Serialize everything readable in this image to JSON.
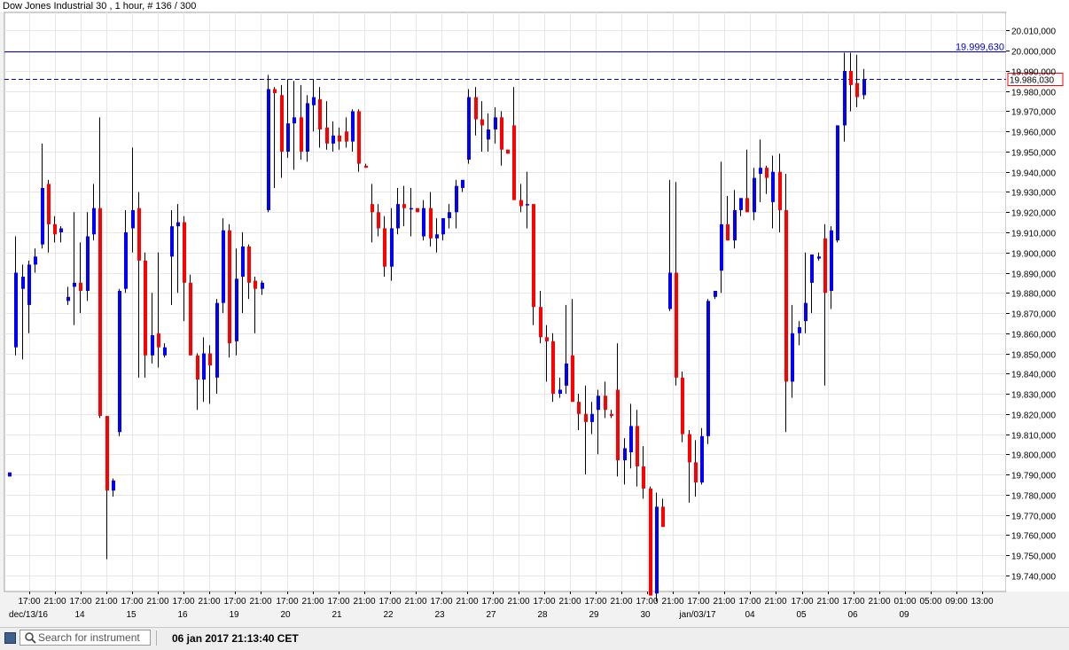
{
  "window": {
    "title": "Dow Jones Industrial 30 , 1 hour, # 136 / 300"
  },
  "search": {
    "placeholder": "Search for instrument"
  },
  "status": {
    "timestamp": "06 jan 2017 21:13:40 CET"
  },
  "icons": {
    "search": "search-icon",
    "bookmark": "bookmark-icon"
  },
  "colors": {
    "up": "#0000ff",
    "down": "#ff0000",
    "wick": "#000000",
    "level_line": "#0000c8",
    "price_label_border": "#ff0000"
  },
  "chart_data": {
    "type": "candlestick",
    "title": "Dow Jones Industrial 30 , 1 hour, # 136 / 300",
    "grid": true,
    "y_axis_position": "right",
    "ylim": [
      19732,
      20019
    ],
    "yticks": [
      19740,
      19750,
      19760,
      19770,
      19780,
      19790,
      19800,
      19810,
      19820,
      19830,
      19840,
      19850,
      19860,
      19870,
      19880,
      19890,
      19900,
      19910,
      19920,
      19930,
      19940,
      19950,
      19960,
      19970,
      19980,
      19990,
      20000,
      20010
    ],
    "ytick_labels": [
      "19.740,000",
      "19.750,000",
      "19.760,000",
      "19.770,000",
      "19.780,000",
      "19.790,000",
      "19.800,000",
      "19.810,000",
      "19.820,000",
      "19.830,000",
      "19.840,000",
      "19.850,000",
      "19.860,000",
      "19.870,000",
      "19.880,000",
      "19.890,000",
      "19.900,000",
      "19.910,000",
      "19.920,000",
      "19.930,000",
      "19.940,000",
      "19.950,000",
      "19.960,000",
      "19.970,000",
      "19.980,000",
      "19.990,000",
      "20.000,000",
      "20.010,000"
    ],
    "time_labels": [
      "17:00",
      "21:00",
      "17:00",
      "21:00",
      "17:00",
      "21:00",
      "17:00",
      "21:00",
      "17:00",
      "21:00",
      "17:00",
      "21:00",
      "17:00",
      "21:00",
      "17:00",
      "21:00",
      "17:00",
      "21:00",
      "17:00",
      "21:00",
      "17:00",
      "21:00",
      "17:00",
      "21:00",
      "17:00",
      "21:00",
      "17:00",
      "21:00",
      "17:00",
      "21:00",
      "17:00",
      "21:00",
      "17:00",
      "21:00",
      "01:00",
      "05:00",
      "09:00",
      "13:00"
    ],
    "date_labels": [
      "dec/13/16",
      "14",
      "15",
      "16",
      "19",
      "20",
      "21",
      "22",
      "23",
      "27",
      "28",
      "29",
      "30",
      "jan/03/17",
      "04",
      "05",
      "06",
      "09"
    ],
    "levels": [
      {
        "label": "19.999,630",
        "value": 19999.63,
        "style": "solid"
      },
      {
        "label": "19.986,030",
        "value": 19986.03,
        "style": "dashed"
      }
    ],
    "candles": [
      {
        "o": 19789,
        "h": 19791,
        "l": 19789,
        "c": 19791
      },
      {
        "o": 19853,
        "h": 19908,
        "l": 19849,
        "c": 19890
      },
      {
        "o": 19882,
        "h": 19894,
        "l": 19847,
        "c": 19888
      },
      {
        "o": 19874,
        "h": 19896,
        "l": 19860,
        "c": 19894
      },
      {
        "o": 19894,
        "h": 19902,
        "l": 19890,
        "c": 19898
      },
      {
        "o": 19904,
        "h": 19954,
        "l": 19902,
        "c": 19932
      },
      {
        "o": 19934,
        "h": 19936,
        "l": 19900,
        "c": 19914
      },
      {
        "o": 19914,
        "h": 19918,
        "l": 19905,
        "c": 19909
      },
      {
        "o": 19910,
        "h": 19913,
        "l": 19905,
        "c": 19912
      },
      {
        "o": 19876,
        "h": 19883,
        "l": 19874,
        "c": 19878
      },
      {
        "o": 19883,
        "h": 19920,
        "l": 19864,
        "c": 19885
      },
      {
        "o": 19885,
        "h": 19905,
        "l": 19870,
        "c": 19881
      },
      {
        "o": 19881,
        "h": 19920,
        "l": 19876,
        "c": 19908
      },
      {
        "o": 19909,
        "h": 19934,
        "l": 19906,
        "c": 19922
      },
      {
        "o": 19922,
        "h": 19967,
        "l": 19818,
        "c": 19819
      },
      {
        "o": 19819,
        "h": 19819,
        "l": 19748,
        "c": 19782
      },
      {
        "o": 19782,
        "h": 19788,
        "l": 19779,
        "c": 19787
      },
      {
        "o": 19811,
        "h": 19882,
        "l": 19809,
        "c": 19881
      },
      {
        "o": 19882,
        "h": 19921,
        "l": 19880,
        "c": 19910
      },
      {
        "o": 19912,
        "h": 19952,
        "l": 19900,
        "c": 19921
      },
      {
        "o": 19922,
        "h": 19930,
        "l": 19838,
        "c": 19896
      },
      {
        "o": 19896,
        "h": 19900,
        "l": 19838,
        "c": 19849
      },
      {
        "o": 19849,
        "h": 19880,
        "l": 19845,
        "c": 19859
      },
      {
        "o": 19860,
        "h": 19900,
        "l": 19843,
        "c": 19853
      },
      {
        "o": 19849,
        "h": 19855,
        "l": 19848,
        "c": 19853
      },
      {
        "o": 19898,
        "h": 19921,
        "l": 19874,
        "c": 19913
      },
      {
        "o": 19913,
        "h": 19924,
        "l": 19880,
        "c": 19915
      },
      {
        "o": 19915,
        "h": 19918,
        "l": 19866,
        "c": 19885
      },
      {
        "o": 19885,
        "h": 19889,
        "l": 19850,
        "c": 19849
      },
      {
        "o": 19849,
        "h": 19850,
        "l": 19822,
        "c": 19837
      },
      {
        "o": 19837,
        "h": 19858,
        "l": 19826,
        "c": 19850
      },
      {
        "o": 19850,
        "h": 19854,
        "l": 19825,
        "c": 19844
      },
      {
        "o": 19838,
        "h": 19877,
        "l": 19830,
        "c": 19875
      },
      {
        "o": 19875,
        "h": 19917,
        "l": 19870,
        "c": 19911
      },
      {
        "o": 19911,
        "h": 19914,
        "l": 19848,
        "c": 19855
      },
      {
        "o": 19856,
        "h": 19902,
        "l": 19849,
        "c": 19887
      },
      {
        "o": 19888,
        "h": 19910,
        "l": 19870,
        "c": 19903
      },
      {
        "o": 19903,
        "h": 19904,
        "l": 19877,
        "c": 19885
      },
      {
        "o": 19886,
        "h": 19888,
        "l": 19860,
        "c": 19882
      },
      {
        "o": 19882,
        "h": 19886,
        "l": 19879,
        "c": 19885
      },
      {
        "o": 19921,
        "h": 19988,
        "l": 19920,
        "c": 19981
      },
      {
        "o": 19981,
        "h": 19982,
        "l": 19932,
        "c": 19979
      },
      {
        "o": 19978,
        "h": 19983,
        "l": 19937,
        "c": 19950
      },
      {
        "o": 19950,
        "h": 19986,
        "l": 19947,
        "c": 19964
      },
      {
        "o": 19964,
        "h": 19985,
        "l": 19941,
        "c": 19967
      },
      {
        "o": 19967,
        "h": 19983,
        "l": 19946,
        "c": 19950
      },
      {
        "o": 19950,
        "h": 19978,
        "l": 19945,
        "c": 19974
      },
      {
        "o": 19973,
        "h": 19986,
        "l": 19960,
        "c": 19977
      },
      {
        "o": 19976,
        "h": 19982,
        "l": 19952,
        "c": 19961
      },
      {
        "o": 19962,
        "h": 19975,
        "l": 19951,
        "c": 19954
      },
      {
        "o": 19954,
        "h": 19965,
        "l": 19950,
        "c": 19958
      },
      {
        "o": 19958,
        "h": 19962,
        "l": 19951,
        "c": 19955
      },
      {
        "o": 19960,
        "h": 19967,
        "l": 19952,
        "c": 19955
      },
      {
        "o": 19955,
        "h": 19971,
        "l": 19950,
        "c": 19970
      },
      {
        "o": 19970,
        "h": 19971,
        "l": 19940,
        "c": 19944
      },
      {
        "o": 19943,
        "h": 19944,
        "l": 19942,
        "c": 19942
      },
      {
        "o": 19924,
        "h": 19934,
        "l": 19905,
        "c": 19920
      },
      {
        "o": 19920,
        "h": 19924,
        "l": 19908,
        "c": 19912
      },
      {
        "o": 19912,
        "h": 19918,
        "l": 19888,
        "c": 19893
      },
      {
        "o": 19893,
        "h": 19922,
        "l": 19886,
        "c": 19912
      },
      {
        "o": 19912,
        "h": 19932,
        "l": 19909,
        "c": 19924
      },
      {
        "o": 19924,
        "h": 19933,
        "l": 19913,
        "c": 19922
      },
      {
        "o": 19922,
        "h": 19932,
        "l": 19908,
        "c": 19922
      },
      {
        "o": 19922,
        "h": 19922,
        "l": 19920,
        "c": 19920
      },
      {
        "o": 19908,
        "h": 19926,
        "l": 19906,
        "c": 19922
      },
      {
        "o": 19922,
        "h": 19930,
        "l": 19903,
        "c": 19907
      },
      {
        "o": 19907,
        "h": 19917,
        "l": 19900,
        "c": 19909
      },
      {
        "o": 19909,
        "h": 19916,
        "l": 19906,
        "c": 19917
      },
      {
        "o": 19917,
        "h": 19924,
        "l": 19912,
        "c": 19920
      },
      {
        "o": 19920,
        "h": 19936,
        "l": 19912,
        "c": 19933
      },
      {
        "o": 19932,
        "h": 19936,
        "l": 19930,
        "c": 19936
      },
      {
        "o": 19946,
        "h": 19981,
        "l": 19944,
        "c": 19977
      },
      {
        "o": 19977,
        "h": 19982,
        "l": 19958,
        "c": 19966
      },
      {
        "o": 19966,
        "h": 19975,
        "l": 19950,
        "c": 19963
      },
      {
        "o": 19956,
        "h": 19969,
        "l": 19950,
        "c": 19961
      },
      {
        "o": 19961,
        "h": 19972,
        "l": 19954,
        "c": 19967
      },
      {
        "o": 19967,
        "h": 19970,
        "l": 19943,
        "c": 19951
      },
      {
        "o": 19951,
        "h": 19950,
        "l": 19949,
        "c": 19949
      },
      {
        "o": 19963,
        "h": 19982,
        "l": 19931,
        "c": 19926
      },
      {
        "o": 19926,
        "h": 19934,
        "l": 19920,
        "c": 19923
      },
      {
        "o": 19924,
        "h": 19940,
        "l": 19912,
        "c": 19924
      },
      {
        "o": 19924,
        "h": 19924,
        "l": 19864,
        "c": 19873
      },
      {
        "o": 19873,
        "h": 19881,
        "l": 19855,
        "c": 19858
      },
      {
        "o": 19858,
        "h": 19864,
        "l": 19836,
        "c": 19856
      },
      {
        "o": 19856,
        "h": 19860,
        "l": 19826,
        "c": 19830
      },
      {
        "o": 19830,
        "h": 19838,
        "l": 19828,
        "c": 19832
      },
      {
        "o": 19834,
        "h": 19874,
        "l": 19830,
        "c": 19845
      },
      {
        "o": 19849,
        "h": 19877,
        "l": 19826,
        "c": 19826
      },
      {
        "o": 19826,
        "h": 19830,
        "l": 19812,
        "c": 19820
      },
      {
        "o": 19820,
        "h": 19834,
        "l": 19790,
        "c": 19816
      },
      {
        "o": 19816,
        "h": 19826,
        "l": 19810,
        "c": 19820
      },
      {
        "o": 19822,
        "h": 19832,
        "l": 19800,
        "c": 19829
      },
      {
        "o": 19829,
        "h": 19836,
        "l": 19818,
        "c": 19822
      },
      {
        "o": 19820,
        "h": 19822,
        "l": 19818,
        "c": 19819
      },
      {
        "o": 19832,
        "h": 19855,
        "l": 19789,
        "c": 19797
      },
      {
        "o": 19797,
        "h": 19808,
        "l": 19785,
        "c": 19803
      },
      {
        "o": 19801,
        "h": 19825,
        "l": 19793,
        "c": 19814
      },
      {
        "o": 19814,
        "h": 19822,
        "l": 19784,
        "c": 19794
      },
      {
        "o": 19794,
        "h": 19804,
        "l": 19778,
        "c": 19783
      },
      {
        "o": 19783,
        "h": 19784,
        "l": 19731,
        "c": 19730
      },
      {
        "o": 19731,
        "h": 19781,
        "l": 19727,
        "c": 19774
      },
      {
        "o": 19774,
        "h": 19778,
        "l": 19764,
        "c": 19764
      },
      {
        "o": 19872,
        "h": 19936,
        "l": 19871,
        "c": 19890
      },
      {
        "o": 19890,
        "h": 19935,
        "l": 19834,
        "c": 19838
      },
      {
        "o": 19838,
        "h": 19841,
        "l": 19806,
        "c": 19810
      },
      {
        "o": 19810,
        "h": 19812,
        "l": 19776,
        "c": 19796
      },
      {
        "o": 19796,
        "h": 19807,
        "l": 19779,
        "c": 19786
      },
      {
        "o": 19786,
        "h": 19813,
        "l": 19785,
        "c": 19809
      },
      {
        "o": 19809,
        "h": 19877,
        "l": 19805,
        "c": 19876
      },
      {
        "o": 19878,
        "h": 19881,
        "l": 19877,
        "c": 19881
      },
      {
        "o": 19891,
        "h": 19945,
        "l": 19880,
        "c": 19914
      },
      {
        "o": 19914,
        "h": 19928,
        "l": 19910,
        "c": 19906
      },
      {
        "o": 19906,
        "h": 19931,
        "l": 19902,
        "c": 19921
      },
      {
        "o": 19921,
        "h": 19926,
        "l": 19918,
        "c": 19927
      },
      {
        "o": 19927,
        "h": 19951,
        "l": 19921,
        "c": 19920
      },
      {
        "o": 19920,
        "h": 19942,
        "l": 19916,
        "c": 19937
      },
      {
        "o": 19939,
        "h": 19956,
        "l": 19925,
        "c": 19942
      },
      {
        "o": 19942,
        "h": 19943,
        "l": 19929,
        "c": 19937
      },
      {
        "o": 19925,
        "h": 19948,
        "l": 19912,
        "c": 19940
      },
      {
        "o": 19940,
        "h": 19949,
        "l": 19910,
        "c": 19921
      },
      {
        "o": 19921,
        "h": 19939,
        "l": 19811,
        "c": 19836
      },
      {
        "o": 19836,
        "h": 19874,
        "l": 19828,
        "c": 19860
      },
      {
        "o": 19860,
        "h": 19866,
        "l": 19854,
        "c": 19863
      },
      {
        "o": 19866,
        "h": 19900,
        "l": 19860,
        "c": 19875
      },
      {
        "o": 19885,
        "h": 19899,
        "l": 19870,
        "c": 19899
      },
      {
        "o": 19897,
        "h": 19900,
        "l": 19896,
        "c": 19898
      },
      {
        "o": 19907,
        "h": 19914,
        "l": 19834,
        "c": 19880
      },
      {
        "o": 19881,
        "h": 19913,
        "l": 19872,
        "c": 19911
      },
      {
        "o": 19906,
        "h": 19943,
        "l": 19905,
        "c": 19963
      },
      {
        "o": 19963,
        "h": 19999,
        "l": 19955,
        "c": 19990
      },
      {
        "o": 19990,
        "h": 19999,
        "l": 19970,
        "c": 19983
      },
      {
        "o": 19984,
        "h": 19998,
        "l": 19972,
        "c": 19977
      },
      {
        "o": 19978,
        "h": 19991,
        "l": 19976,
        "c": 19986
      }
    ]
  }
}
